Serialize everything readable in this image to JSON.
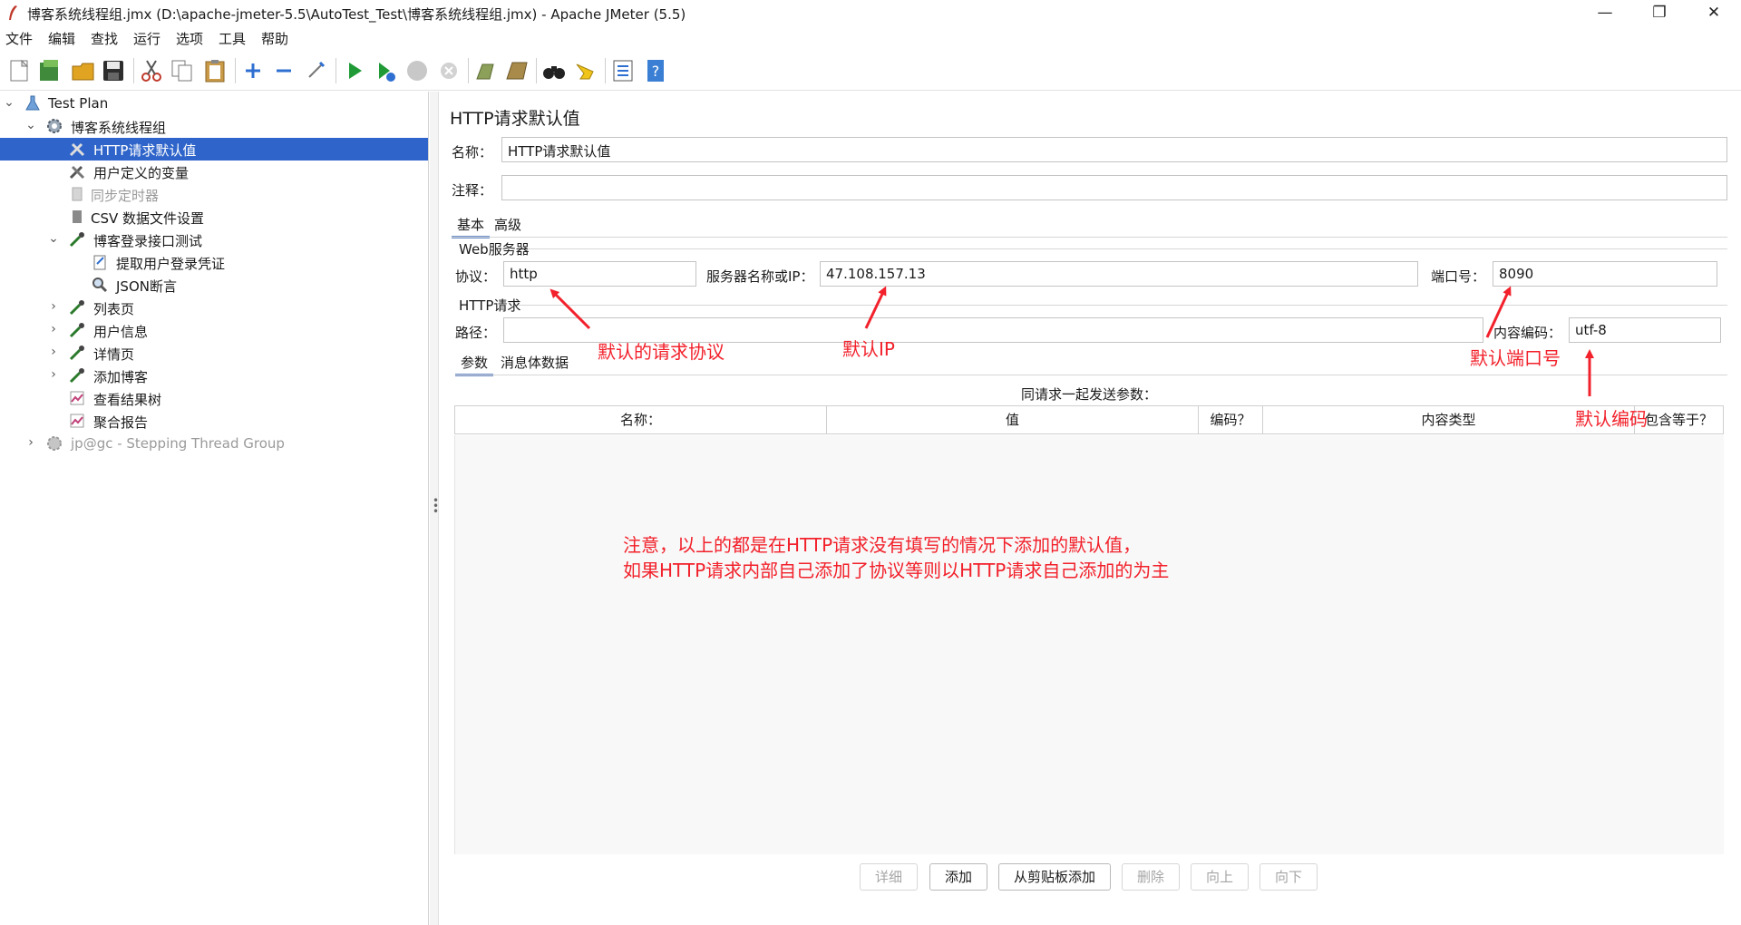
{
  "window": {
    "title": "博客系统线程组.jmx (D:\\apache-jmeter-5.5\\AutoTest_Test\\博客系统线程组.jmx) - Apache JMeter (5.5)",
    "minimize": "—",
    "restore": "❐",
    "close": "✕"
  },
  "menu": [
    "文件",
    "编辑",
    "查找",
    "运行",
    "选项",
    "工具",
    "帮助"
  ],
  "toolbar": {
    "icons": [
      "new-icon",
      "templates-icon",
      "open-icon",
      "save-icon",
      "cut-icon",
      "copy-icon",
      "paste-icon",
      "expand-icon",
      "collapse-icon",
      "toggle-icon",
      "start-icon",
      "start-no-pause-icon",
      "stop-icon",
      "shutdown-icon",
      "clear-icon",
      "clear-all-icon",
      "search-icon",
      "reset-search-icon",
      "function-helper-icon",
      "help-icon"
    ]
  },
  "tree": [
    {
      "label": "Test Plan",
      "icon": "test-plan-icon",
      "expanded": true,
      "dim": false
    },
    {
      "label": "博客系统线程组",
      "icon": "thread-group-gear-icon",
      "expanded": true,
      "dim": false
    },
    {
      "label": "HTTP请求默认值",
      "icon": "config-tools-icon",
      "selected": true,
      "dim": false
    },
    {
      "label": "用户定义的变量",
      "icon": "config-tools-icon",
      "dim": false
    },
    {
      "label": "同步定时器",
      "icon": "timer-icon",
      "dim": true
    },
    {
      "label": "CSV 数据文件设置",
      "icon": "csv-file-icon",
      "dim": false
    },
    {
      "label": "博客登录接口测试",
      "icon": "sampler-pipette-icon",
      "expanded": true,
      "dim": false
    },
    {
      "label": "提取用户登录凭证",
      "icon": "extractor-icon",
      "dim": false
    },
    {
      "label": "JSON断言",
      "icon": "assertion-magnifier-icon",
      "dim": false
    },
    {
      "label": "列表页",
      "icon": "sampler-pipette-icon",
      "collapsed": true,
      "dim": false
    },
    {
      "label": "用户信息",
      "icon": "sampler-pipette-icon",
      "collapsed": true,
      "dim": false
    },
    {
      "label": "详情页",
      "icon": "sampler-pipette-icon",
      "collapsed": true,
      "dim": false
    },
    {
      "label": "添加博客",
      "icon": "sampler-pipette-icon",
      "collapsed": true,
      "dim": false
    },
    {
      "label": "查看结果树",
      "icon": "listener-graph-icon",
      "dim": false
    },
    {
      "label": "聚合报告",
      "icon": "listener-graph-icon",
      "dim": false
    },
    {
      "label": "jp@gc - Stepping Thread Group",
      "icon": "thread-group-gear-icon",
      "collapsed": true,
      "dim": true
    }
  ],
  "panel": {
    "title": "HTTP请求默认值",
    "name_label": "名称：",
    "name_value": "HTTP请求默认值",
    "comment_label": "注释：",
    "comment_value": "",
    "tabs": [
      "基本",
      "高级"
    ],
    "web_server_group": "Web服务器",
    "protocol_label": "协议：",
    "protocol_value": "http",
    "server_label": "服务器名称或IP：",
    "server_value": "47.108.157.13",
    "port_label": "端口号：",
    "port_value": "8090",
    "http_request_group": "HTTP请求",
    "path_label": "路径：",
    "path_value": "",
    "encoding_label": "内容编码：",
    "encoding_value": "utf-8",
    "sub_tabs": [
      "参数",
      "消息体数据"
    ],
    "params_caption": "同请求一起发送参数：",
    "columns": [
      "名称：",
      "值",
      "编码？",
      "内容类型",
      "包含等于？"
    ],
    "buttons": [
      {
        "label": "详细",
        "enabled": false
      },
      {
        "label": "添加",
        "enabled": true
      },
      {
        "label": "从剪贴板添加",
        "enabled": true
      },
      {
        "label": "删除",
        "enabled": false
      },
      {
        "label": "向上",
        "enabled": false
      },
      {
        "label": "向下",
        "enabled": false
      }
    ]
  },
  "annotations": {
    "protocol": "默认的请求协议",
    "ip": "默认IP",
    "port": "默认端口号",
    "encoding": "默认编码",
    "note_line1": "注意，以上的都是在HTTP请求没有填写的情况下添加的默认值，",
    "note_line2": "如果HTTP请求内部自己添加了协议等则以HTTP请求自己添加的为主",
    "color": "#f2212b"
  },
  "colors": {
    "selection": "#2f65ca",
    "tab_underline": "#6b8ec9"
  }
}
